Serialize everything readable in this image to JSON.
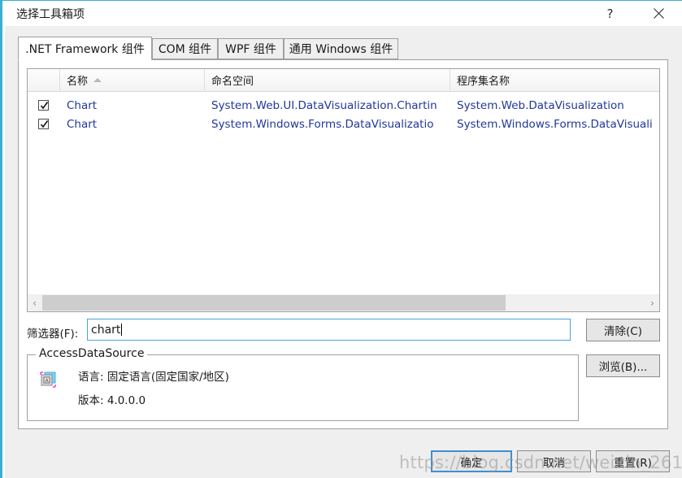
{
  "window": {
    "title": "选择工具箱项",
    "accent_color": "#3aafcf",
    "body_background": "#efeff0",
    "titlebar_buttons": [
      {
        "name": "help-button",
        "label": "?"
      },
      {
        "name": "close-button",
        "label": "✕"
      }
    ]
  },
  "tabs": [
    {
      "label": ".NET Framework 组件",
      "active": true
    },
    {
      "label": "COM 组件",
      "active": false
    },
    {
      "label": "WPF 组件",
      "active": false
    },
    {
      "label": "通用 Windows 组件",
      "active": false
    }
  ],
  "listview": {
    "columns": [
      {
        "label": "",
        "key": "check"
      },
      {
        "label": "名称",
        "sorted": "asc"
      },
      {
        "label": "命名空间"
      },
      {
        "label": "程序集名称"
      }
    ],
    "rows": [
      {
        "checked": true,
        "name": "Chart",
        "namespace": "System.Web.UI.DataVisualization.Chartin",
        "assembly": "System.Web.DataVisualization"
      },
      {
        "checked": true,
        "name": "Chart",
        "namespace": "System.Windows.Forms.DataVisualizatio",
        "assembly": "System.Windows.Forms.DataVisuali"
      }
    ],
    "text_color": "#20379b",
    "scrollbar": {
      "left_arrow": "‹",
      "right_arrow": "›",
      "thumb_fraction": 0.74
    }
  },
  "filter": {
    "label": "筛选器(F):",
    "value": "chart",
    "placeholder": ""
  },
  "details": {
    "title": "AccessDataSource",
    "icon": "access-data-source-icon",
    "lines": [
      "语言: 固定语言(固定国家/地区)",
      "版本: 4.0.0.0"
    ]
  },
  "side_buttons": {
    "clear": "清除(C)",
    "browse": "浏览(B)..."
  },
  "footer_buttons": {
    "ok": "确定",
    "cancel": "取消",
    "reset": "重置(R)"
  },
  "watermark": {
    "text": "https://blog.csdn.net/weixin_261"
  }
}
